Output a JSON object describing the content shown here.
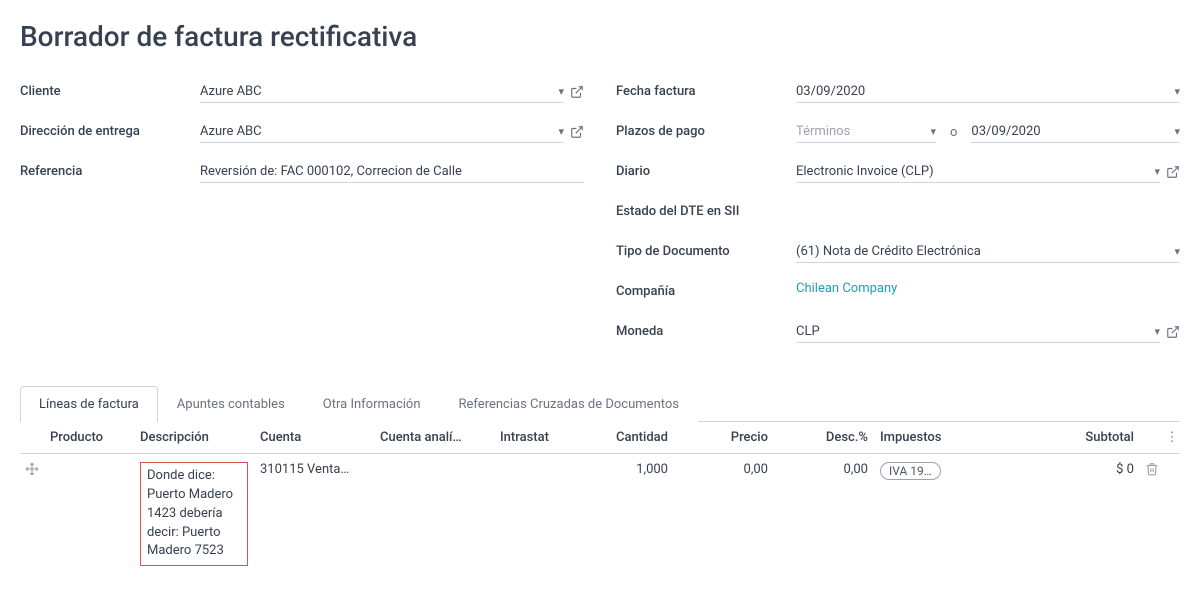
{
  "title": "Borrador de factura rectificativa",
  "left": {
    "cliente_label": "Cliente",
    "cliente_value": "Azure ABC",
    "direccion_label": "Dirección de entrega",
    "direccion_value": "Azure ABC",
    "referencia_label": "Referencia",
    "referencia_value": "Reversión de: FAC 000102, Correcion de Calle"
  },
  "right": {
    "fecha_label": "Fecha factura",
    "fecha_value": "03/09/2020",
    "plazos_label": "Plazos de pago",
    "plazos_placeholder": "Términos",
    "plazos_sep": "o",
    "plazos_date": "03/09/2020",
    "diario_label": "Diario",
    "diario_value": "Electronic Invoice (CLP)",
    "estado_label": "Estado del DTE en SII",
    "tipo_label": "Tipo de Documento",
    "tipo_value": "(61) Nota de Crédito Electrónica",
    "compania_label": "Compañía",
    "compania_value": "Chilean Company",
    "moneda_label": "Moneda",
    "moneda_value": "CLP"
  },
  "tabs": {
    "t0": "Líneas de factura",
    "t1": "Apuntes contables",
    "t2": "Otra Información",
    "t3": "Referencias Cruzadas de Documentos"
  },
  "table": {
    "headers": {
      "producto": "Producto",
      "descripcion": "Descripción",
      "cuenta": "Cuenta",
      "analitica": "Cuenta analí…",
      "intrastat": "Intrastat",
      "cantidad": "Cantidad",
      "precio": "Precio",
      "desc": "Desc.%",
      "impuestos": "Impuestos",
      "subtotal": "Subtotal"
    },
    "row": {
      "descripcion": "Donde dice: Puerto Madero 1423 debería decir: Puerto Madero 7523",
      "cuenta": "310115 Venta…",
      "cantidad": "1,000",
      "precio": "0,00",
      "desc": "0,00",
      "impuestos": "IVA 19…",
      "subtotal": "$ 0"
    }
  }
}
